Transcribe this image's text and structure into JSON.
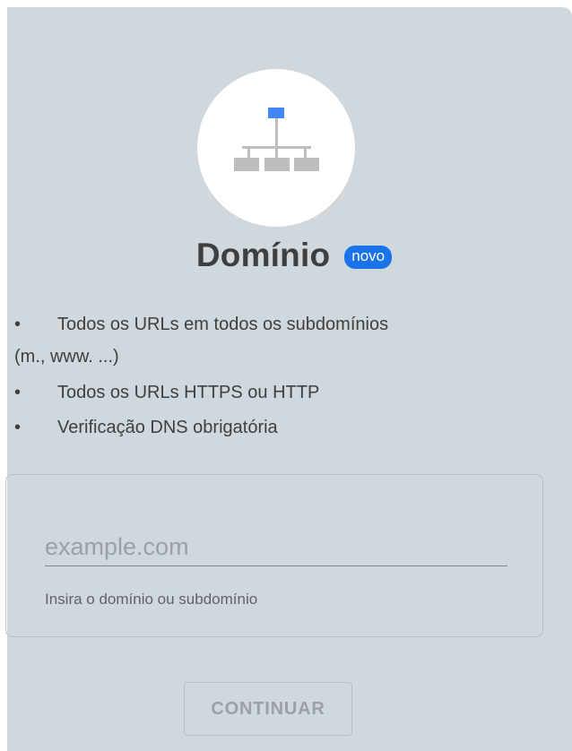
{
  "property": {
    "title": "Domínio",
    "badge": "novo",
    "icon": "sitemap-icon",
    "colors": {
      "card_background": "#d0d8dd",
      "accent": "#1a73e8",
      "icon_node": "#bdbdbd",
      "text": "#3c4043"
    }
  },
  "features": [
    {
      "bullet": "•",
      "text": "Todos os URLs em todos os subdomínios",
      "continuation": "(m., www. ...)"
    },
    {
      "bullet": "•",
      "text": "Todos os URLs HTTPS ou HTTP"
    },
    {
      "bullet": "•",
      "text": "Verificação DNS obrigatória"
    }
  ],
  "domain_input": {
    "value": "",
    "placeholder": "example.com",
    "helper": "Insira o domínio ou subdomínio"
  },
  "continue_button": {
    "label": "CONTINUAR",
    "enabled": false
  }
}
